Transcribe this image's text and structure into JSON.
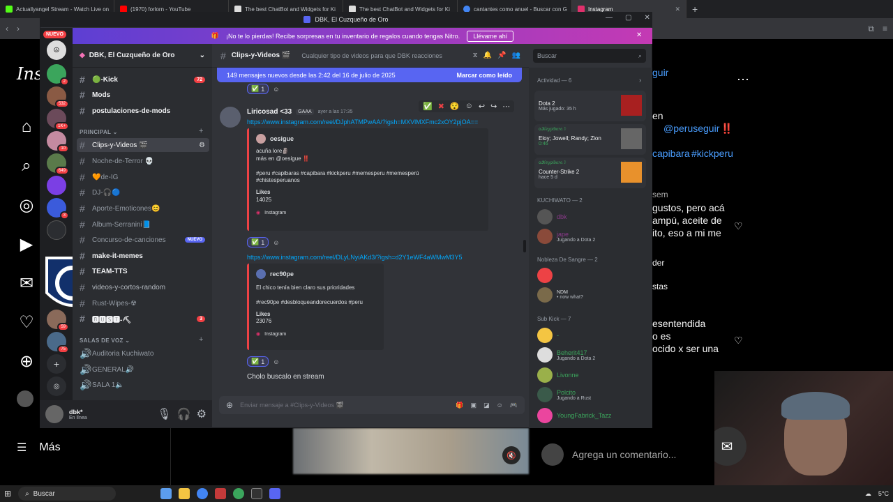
{
  "browser": {
    "tabs": [
      {
        "title": "Actuallyangel Stream - Watch Live on",
        "color": "#53fc18"
      },
      {
        "title": "(1970) forlorn - YouTube",
        "color": "#ff0000"
      },
      {
        "title": "The best ChatBot and Widgets for Ki",
        "color": "#ffffff"
      },
      {
        "title": "The best ChatBot and Widgets for Ki",
        "color": "#ffffff"
      },
      {
        "title": "cantantes como anuel - Buscar con G",
        "color": "#4285f4"
      },
      {
        "title": "Instagram",
        "color": "#e1306c"
      }
    ],
    "new_tab": "+"
  },
  "instagram": {
    "logo": "Ins",
    "more": "Más",
    "post_lines": [
      "guir",
      "en",
      "@peruseguir",
      "‼️",
      "capibara",
      "#kickperu",
      "sem",
      "gustos, pero acá",
      "ampú, aceite de",
      "ito, eso a mi me",
      "der",
      "stas",
      "esentendida",
      "o es",
      "ocido x ser una"
    ],
    "comment_placeholder": "Agrega un comentario..."
  },
  "discord": {
    "window_title": "DBK, El Cuzqueño de Oro",
    "nitro_text": "¡No te lo pierdas! Recibe sorpresas en tu inventario de regalos cuando tengas Nitro.",
    "nitro_button": "Llévame ahí",
    "new_label": "NUEVO",
    "server_name": "DBK, El Cuzqueño de Oro",
    "guild_badges": [
      "2",
      "532",
      "1K+",
      "10",
      "649",
      "3",
      "59",
      "75"
    ],
    "channels_top": [
      {
        "name": "🟢-Kick",
        "badge": "72",
        "bold": true
      },
      {
        "name": "Mods",
        "bold": true
      },
      {
        "name": "postulaciones-de-mods",
        "bold": true
      }
    ],
    "category_principal": "PRINCIPAL",
    "channels_principal": [
      {
        "name": "Clips-y-Videos 🎬",
        "selected": true
      },
      {
        "name": "Noche-de-Terror 💀"
      },
      {
        "name": "🧡de-IG"
      },
      {
        "name": "DJ-🎧🔵"
      },
      {
        "name": "Aporte-Emoticones😊"
      },
      {
        "name": "Album-Serranini📘"
      },
      {
        "name": "Concurso-de-canciones",
        "new": "NUEVO"
      },
      {
        "name": "make-it-memes",
        "bold": true
      },
      {
        "name": "TEAM-TTS",
        "bold": true
      },
      {
        "name": "videos-y-cortos-random"
      },
      {
        "name": "Rust-Wipes-☢"
      },
      {
        "name": "🅱🆄🆂🆃-⛏",
        "badge": "3",
        "bold": true
      }
    ],
    "category_voice": "SALAS DE VOZ",
    "voice_channels": [
      "Auditoria Kuchiwato",
      "GENERAL🔊",
      "SALA 1🔈"
    ],
    "user": {
      "name": "dbk*",
      "status": "En línea"
    },
    "channel_header": {
      "name": "Clips-y-Videos 🎬",
      "topic": "Cualquier tipo de videos para que DBK reacciones"
    },
    "search_placeholder": "Buscar",
    "new_messages_bar": {
      "text": "149 mensajes nuevos desde las 2:42 del 16 de julio de 2025",
      "action": "Marcar como leído"
    },
    "messages": {
      "reaction_count": "1",
      "author": "Liricosad <33",
      "author_tag": "GAAA",
      "timestamp": "ayer a las 17:35",
      "link1": "https://www.instagram.com/reel/DJphATMPwAA/?igsh=MXVlMXFmc2xOY2pjOA==",
      "embed1": {
        "author": "oesigue",
        "line1": "acuña lore🗿",
        "line2": "más en @oesigue ‼️",
        "line3": "#peru #capibaras #capibara #kickperu #memesperu #memesperú",
        "line4": "#chistesperuanos",
        "likes_label": "Likes",
        "likes": "14025",
        "footer": "Instagram"
      },
      "link2": "https://www.instagram.com/reel/DLyLNyiAKd3/?igsh=d2Y1eWF4aWMwM3Y5",
      "embed2": {
        "author": "rec90pe",
        "line1": "El chico tenía bien claro sus prioridades",
        "line2": "#rec90pe #desbloqueandorecuerdos #peru",
        "likes_label": "Likes",
        "likes": "23076",
        "footer": "Instagram"
      },
      "last_text": "Cholo buscalo en stream"
    },
    "composer_placeholder": "Enviar mensaje a #Clips-y-Videos 🎬",
    "members": {
      "activity_title": "Actividad — 6",
      "activities": [
        {
          "user": "",
          "game": "Dota 2",
          "detail": "Más jugado: 35 h"
        },
        {
          "user": "ⲟ𝒦𝑒𝑦𝑝𝑖𝑏𝑎𝑟𝑎☽",
          "game": "Eloy; Jowell; Randy; Zion",
          "detail": "0:46"
        },
        {
          "user": "ⲟ𝒦𝑒𝑦𝑝𝑖𝑏𝑎𝑟𝑎☽",
          "game": "Counter-Strike 2",
          "detail": "hace 5 d"
        }
      ],
      "groups": [
        {
          "title": "KUCHIWATO — 2",
          "items": [
            {
              "name": "dbk",
              "sub": ""
            },
            {
              "name": "jape",
              "sub": "Jugando a Dota 2"
            }
          ]
        },
        {
          "title": "Nobleza De Sangre — 2",
          "items": [
            {
              "name": "",
              "sub": ""
            },
            {
              "name": "NDM",
              "sub": "• now what?"
            }
          ]
        },
        {
          "title": "Sub Kick — 7",
          "items": [
            {
              "name": "-",
              "sub": ""
            },
            {
              "name": "Beherit417",
              "sub": "Jugando a Dota 2"
            },
            {
              "name": "Livonne",
              "sub": ""
            },
            {
              "name": "Polcito",
              "sub": "Jugando a Rust"
            },
            {
              "name": "YoungFabrick_Tazz",
              "sub": ""
            }
          ]
        }
      ]
    }
  },
  "taskbar": {
    "search": "Buscar",
    "weather": "5°C"
  }
}
